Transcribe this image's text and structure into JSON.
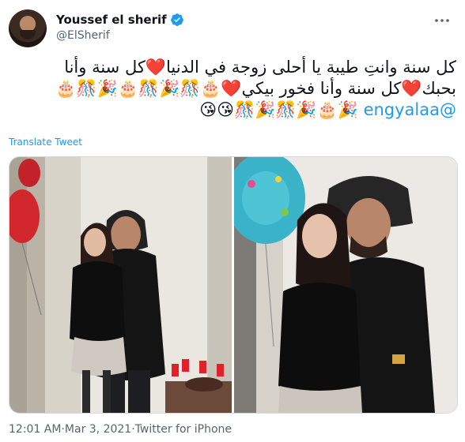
{
  "author": {
    "display_name": "Youssef el sherif",
    "handle": "@ElSherif",
    "verified": true,
    "avatar_icon": "profile-photo"
  },
  "tweet": {
    "lines": [
      "كل سنة وانتِ طيبة يا أحلى زوجة في الدنيا❤️كل سنة وأنا",
      "بحبك❤️كل سنة وأنا فخور بيكي❤️🎂🎊🎉🎊🎂🎉🎊🎂",
      "🎉🎂🎉🎊🎉🎊😘😘"
    ],
    "mention": "@engyalaa",
    "translate_label": "Translate Tweet"
  },
  "media": {
    "photos": [
      {
        "name": "photo-1",
        "subject": "couple-with-balloon-and-cake"
      },
      {
        "name": "photo-2",
        "subject": "couple-with-birthday-balloon"
      }
    ]
  },
  "meta": {
    "time": "12:01 AM",
    "separator": " · ",
    "date": "Mar 3, 2021",
    "source": "Twitter for iPhone"
  },
  "colors": {
    "accent": "#1d9bf0",
    "secondary_text": "#536471",
    "border": "#cfd9de"
  }
}
